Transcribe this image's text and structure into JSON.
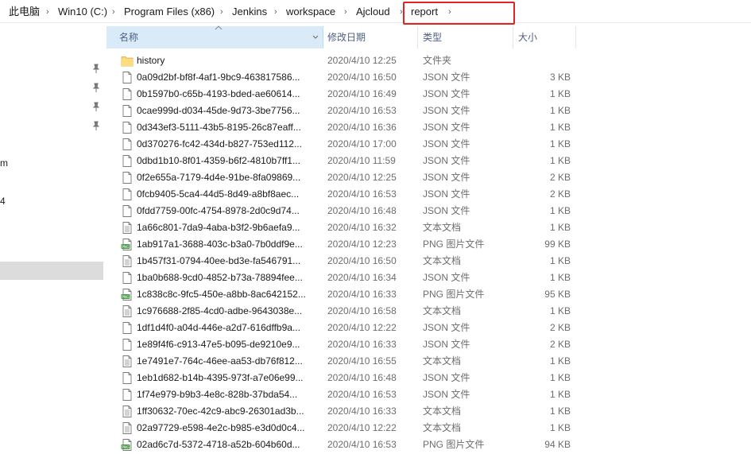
{
  "breadcrumb": [
    "此电脑",
    "Win10 (C:)",
    "Program Files (x86)",
    "Jenkins",
    "workspace",
    "Ajcloud",
    "report"
  ],
  "columns": {
    "name": "名称",
    "date": "修改日期",
    "type": "类型",
    "size": "大小"
  },
  "nav_fragments": [
    "m",
    "4"
  ],
  "files": [
    {
      "icon": "folder",
      "name": "history",
      "date": "2020/4/10 12:25",
      "type": "文件夹",
      "size": ""
    },
    {
      "icon": "file",
      "name": "0a09d2bf-bf8f-4af1-9bc9-463817586...",
      "date": "2020/4/10 16:50",
      "type": "JSON 文件",
      "size": "3 KB"
    },
    {
      "icon": "file",
      "name": "0b1597b0-c65b-4193-bded-ae60614...",
      "date": "2020/4/10 16:49",
      "type": "JSON 文件",
      "size": "1 KB"
    },
    {
      "icon": "file",
      "name": "0cae999d-d034-45de-9d73-3be7756...",
      "date": "2020/4/10 16:53",
      "type": "JSON 文件",
      "size": "1 KB"
    },
    {
      "icon": "file",
      "name": "0d343ef3-5111-43b5-8195-26c87eaff...",
      "date": "2020/4/10 16:36",
      "type": "JSON 文件",
      "size": "1 KB"
    },
    {
      "icon": "file",
      "name": "0d370276-fc42-434d-b827-753ed112...",
      "date": "2020/4/10 17:00",
      "type": "JSON 文件",
      "size": "1 KB"
    },
    {
      "icon": "file",
      "name": "0dbd1b10-8f01-4359-b6f2-4810b7ff1...",
      "date": "2020/4/10 11:59",
      "type": "JSON 文件",
      "size": "1 KB"
    },
    {
      "icon": "file",
      "name": "0f2e655a-7179-4d4e-91be-8fa09869...",
      "date": "2020/4/10 12:25",
      "type": "JSON 文件",
      "size": "2 KB"
    },
    {
      "icon": "file",
      "name": "0fcb9405-5ca4-44d5-8d49-a8bf8aec...",
      "date": "2020/4/10 16:53",
      "type": "JSON 文件",
      "size": "2 KB"
    },
    {
      "icon": "file",
      "name": "0fdd7759-00fc-4754-8978-2d0c9d74...",
      "date": "2020/4/10 16:48",
      "type": "JSON 文件",
      "size": "1 KB"
    },
    {
      "icon": "text",
      "name": "1a66c801-7da9-4aba-b3f2-9b6aefa9...",
      "date": "2020/4/10 16:32",
      "type": "文本文档",
      "size": "1 KB"
    },
    {
      "icon": "png",
      "name": "1ab917a1-3688-403c-b3a0-7b0ddf9e...",
      "date": "2020/4/10 12:23",
      "type": "PNG 图片文件",
      "size": "99 KB"
    },
    {
      "icon": "text",
      "name": "1b457f31-0794-40ee-bd3e-fa546791...",
      "date": "2020/4/10 16:50",
      "type": "文本文档",
      "size": "1 KB"
    },
    {
      "icon": "file",
      "name": "1ba0b688-9cd0-4852-b73a-78894fee...",
      "date": "2020/4/10 16:34",
      "type": "JSON 文件",
      "size": "1 KB"
    },
    {
      "icon": "png",
      "name": "1c838c8c-9fc5-450e-a8bb-8ac642152...",
      "date": "2020/4/10 16:33",
      "type": "PNG 图片文件",
      "size": "95 KB"
    },
    {
      "icon": "text",
      "name": "1c976688-2f85-4cd0-adbe-9643038e...",
      "date": "2020/4/10 16:58",
      "type": "文本文档",
      "size": "1 KB"
    },
    {
      "icon": "file",
      "name": "1df1d4f0-a04d-446e-a2d7-616dffb9a...",
      "date": "2020/4/10 12:22",
      "type": "JSON 文件",
      "size": "2 KB"
    },
    {
      "icon": "file",
      "name": "1e89f4f6-c913-47e5-b095-de9210e9...",
      "date": "2020/4/10 16:33",
      "type": "JSON 文件",
      "size": "2 KB"
    },
    {
      "icon": "text",
      "name": "1e7491e7-764c-46ee-aa53-db76f812...",
      "date": "2020/4/10 16:55",
      "type": "文本文档",
      "size": "1 KB"
    },
    {
      "icon": "file",
      "name": "1eb1d682-b14b-4395-973f-a7e06e99...",
      "date": "2020/4/10 16:48",
      "type": "JSON 文件",
      "size": "1 KB"
    },
    {
      "icon": "file",
      "name": "1f74e979-b9b3-4e8c-828b-37bda54...",
      "date": "2020/4/10 16:53",
      "type": "JSON 文件",
      "size": "1 KB"
    },
    {
      "icon": "text",
      "name": "1ff30632-70ec-42c9-abc9-26301ad3b...",
      "date": "2020/4/10 16:33",
      "type": "文本文档",
      "size": "1 KB"
    },
    {
      "icon": "text",
      "name": "02a97729-e598-4e2c-b985-e3d0d0c4...",
      "date": "2020/4/10 12:22",
      "type": "文本文档",
      "size": "1 KB"
    },
    {
      "icon": "png",
      "name": "02ad6c7d-5372-4718-a52b-604b60d...",
      "date": "2020/4/10 16:53",
      "type": "PNG 图片文件",
      "size": "94 KB"
    }
  ]
}
